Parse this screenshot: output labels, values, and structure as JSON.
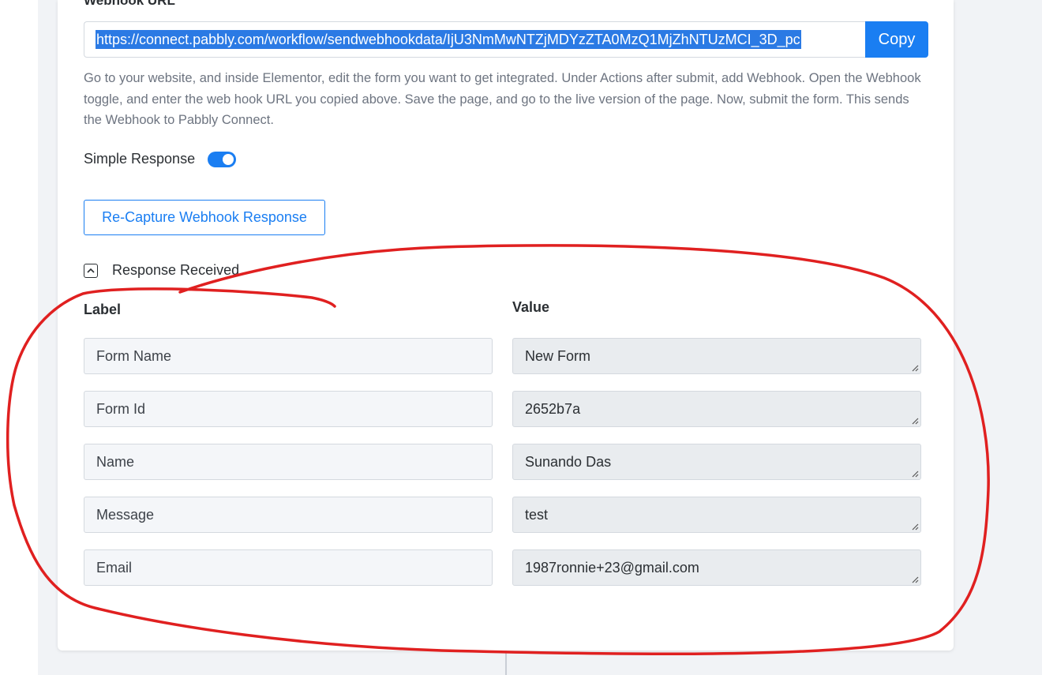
{
  "webhook": {
    "label": "Webhook URL",
    "url": "https://connect.pabbly.com/workflow/sendwebhookdata/IjU3NmMwNTZjMDYzZTA0MzQ1MjZhNTUzMCI_3D_pc",
    "copy_label": "Copy",
    "help_text": "Go to your website, and inside Elementor, edit the form you want to get integrated. Under Actions after submit, add Webhook. Open the Webhook toggle, and enter the web hook URL you copied above. Save the page, and go to the live version of the page. Now, submit the form. This sends the Webhook to Pabbly Connect."
  },
  "simple_response": {
    "label": "Simple Response",
    "enabled": true
  },
  "recapture_label": "Re-Capture Webhook Response",
  "response": {
    "title": "Response Received",
    "label_heading": "Label",
    "value_heading": "Value",
    "rows": [
      {
        "label": "Form Name",
        "value": "New Form"
      },
      {
        "label": "Form Id",
        "value": "2652b7a"
      },
      {
        "label": "Name",
        "value": "Sunando Das"
      },
      {
        "label": "Message",
        "value": "test"
      },
      {
        "label": "Email",
        "value": "1987ronnie+23@gmail.com"
      }
    ]
  },
  "colors": {
    "accent": "#1a7ef2",
    "annotation": "#e02020"
  }
}
